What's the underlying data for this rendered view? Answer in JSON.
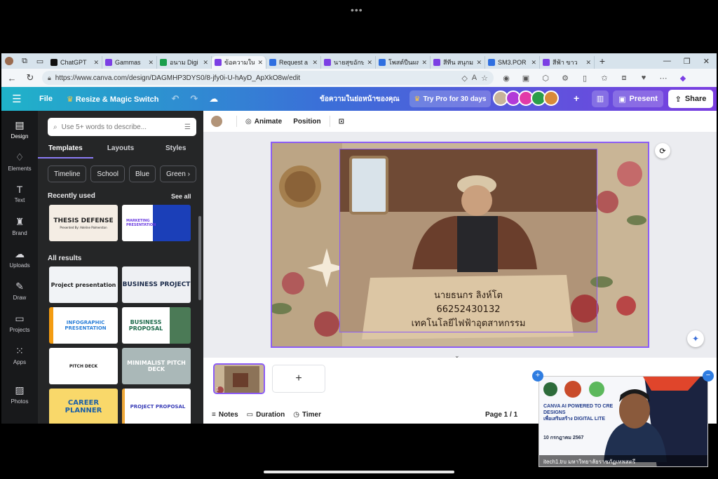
{
  "browser": {
    "tabs": [
      {
        "title": "ChatGPT",
        "color": "#111111"
      },
      {
        "title": "Gammas",
        "color": "#7b3fe4"
      },
      {
        "title": "อนาม Digi",
        "color": "#1a9e4b"
      },
      {
        "title": "ข้อความใน",
        "color": "#7b3fe4",
        "active": true
      },
      {
        "title": "Request a",
        "color": "#2f6fe0"
      },
      {
        "title": "นายสุขอักษ",
        "color": "#7b3fe4"
      },
      {
        "title": "โพสต์ปืนผล",
        "color": "#2f6fe0"
      },
      {
        "title": "สีทีน สนุกม",
        "color": "#7b3fe4"
      },
      {
        "title": "SM3.POR",
        "color": "#2f6fe0"
      },
      {
        "title": "สีฟ้า ขาว",
        "color": "#7b3fe4"
      }
    ],
    "url": "https://www.canva.com/design/DAGMHP3DYS0/8-jfy0i-U-hAyD_ApXkO8w/edit"
  },
  "header": {
    "file": "File",
    "resize": "Resize & Magic Switch",
    "doc_title": "ข้อความในย่อหน้าของคุณ",
    "try_pro": "Try Pro for 30 days",
    "present": "Present",
    "share": "Share"
  },
  "rail": [
    "Design",
    "Elements",
    "Text",
    "Brand",
    "Uploads",
    "Draw",
    "Projects",
    "Apps",
    "Photos"
  ],
  "panel": {
    "search_placeholder": "Use 5+ words to describe...",
    "tabs": [
      "Templates",
      "Layouts",
      "Styles"
    ],
    "chips": [
      "Timeline",
      "School",
      "Blue",
      "Green"
    ],
    "recently_used": "Recently used",
    "see_all": "See all",
    "all_results": "All results",
    "recent": [
      {
        "title": "THESIS DEFENSE",
        "sub": "Presented By: Adeline Palmerston"
      },
      {
        "title": "MARKETING PRESENTATION",
        "sub": ""
      }
    ],
    "results": [
      "Project presentation",
      "BUSINESS PROJECT",
      "INFOGRAPHIC PRESENTATION",
      "BUSINESS PROPOSAL",
      "PITCH DECK",
      "MINIMALIST PITCH DECK",
      "CAREER PLANNER",
      "PROJECT PROPOSAL"
    ]
  },
  "toolbar": {
    "animate": "Animate",
    "position": "Position"
  },
  "slide": {
    "name": "นายธนกร ลิงห์โต",
    "id": "66252430132",
    "dept": "เทคโนโลยีไฟฟ้าอุตสาหกรรม"
  },
  "bottom": {
    "notes": "Notes",
    "duration": "Duration",
    "timer": "Timer",
    "page": "Page 1 / 1",
    "thumb_num": "1"
  },
  "webcam": {
    "title_line1": "CANVA AI POWERED TO CRE",
    "title_line2": "DESIGNS",
    "title_line3": "เพื่อเสริมสร้าง DIGITAL LITE",
    "date": "10 กรกฎาคม 2567",
    "caption": "itech1.tru มหาวิทยาลัยราชภัฏเทพสตรี"
  }
}
